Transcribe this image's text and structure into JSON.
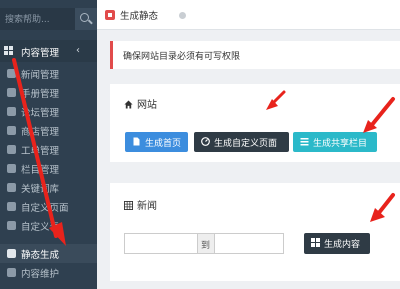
{
  "sidebar": {
    "search_placeholder": "搜索帮助...",
    "parent_label": "内容管理",
    "items": [
      {
        "label": "新闻管理",
        "icon": "list-icon"
      },
      {
        "label": "手册管理",
        "icon": "book-icon"
      },
      {
        "label": "论坛管理",
        "icon": "comments-icon"
      },
      {
        "label": "商店管理",
        "icon": "cart-icon"
      },
      {
        "label": "工单管理",
        "icon": "ticket-icon"
      },
      {
        "label": "栏目管理",
        "icon": "columns-icon"
      },
      {
        "label": "关键词库",
        "icon": "tag-icon"
      },
      {
        "label": "自定义页面",
        "icon": "page-icon"
      },
      {
        "label": "自定义表",
        "icon": "table-icon"
      },
      {
        "label": "静态生成",
        "icon": "file-icon",
        "active": true
      },
      {
        "label": "内容维护",
        "icon": "wrench-icon"
      }
    ]
  },
  "tab": {
    "label": "生成静态"
  },
  "alert": {
    "text": "确保网站目录必须有可写权限"
  },
  "site_panel": {
    "title": "网站",
    "buttons": [
      {
        "label": "生成首页",
        "icon": "file-icon"
      },
      {
        "label": "生成自定义页面",
        "icon": "dashboard-icon"
      },
      {
        "label": "生成共享栏目",
        "icon": "list-icon"
      }
    ]
  },
  "news_panel": {
    "title": "新闻",
    "range_separator": "到",
    "button_label": "生成内容",
    "from_value": "",
    "to_value": ""
  },
  "colors": {
    "sidebar_bg": "#2f4050",
    "accent_red": "#e14b4b",
    "btn_blue": "#3c8dde",
    "btn_dark": "#2f3b45",
    "btn_cyan": "#2bb9c9",
    "annotation_arrow": "#e8231c"
  }
}
